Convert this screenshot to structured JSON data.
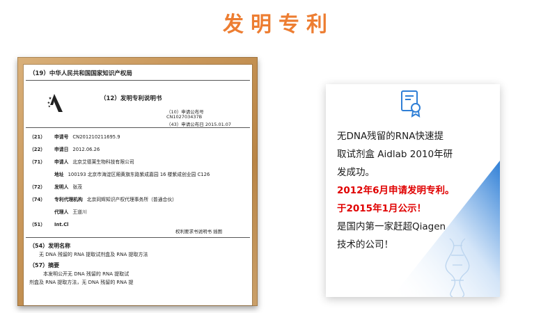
{
  "title": "发明专利",
  "patent": {
    "office": "（19）中华人民共和国国家知识产权局",
    "doc_type": "（12）发明专利说明书",
    "pub_no_label": "（10）申请公布号",
    "pub_no": "CN102703437B",
    "pub_date": "（43）申请公布日 2015.01.07",
    "fields": [
      {
        "num": "（21）",
        "label": "申请号",
        "value": "CN201210211695.9"
      },
      {
        "num": "（22）",
        "label": "申请日",
        "value": "2012.06.26"
      },
      {
        "num": "（71）",
        "label": "申请人",
        "value": "北京艾德莱生物科技有限公司"
      },
      {
        "num": "",
        "label": "地址",
        "value": "100193 北京市海淀区厢黄旗东路紫成嘉园 16 楼紫成创业园 C126"
      },
      {
        "num": "（72）",
        "label": "发明人",
        "value": "张茂"
      },
      {
        "num": "（74）",
        "label": "专利代理机构",
        "value": "北京同辉知识产权代理事务所（普通合伙）"
      },
      {
        "num": "",
        "label": "代理人",
        "value": "王道川"
      },
      {
        "num": "（51）",
        "label": "Int.Cl",
        "value": ""
      }
    ],
    "pages_note": "权利要求书说明书    插图",
    "name_heading": "（54）发明名称",
    "name_value": "无 DNA 残留的 RNA 提取试剂盒及 RNA 提取方法",
    "abstract_heading": "（57）摘要",
    "abstract_line1": "本发明公开无 DNA 残留的 RNA 提取试",
    "abstract_line2": "剂盒及 RNA 提取方法，无 DNA 残留的 RNA 提"
  },
  "card": {
    "icon": "certificate-icon",
    "line1": "无DNA残留的RNA快速提",
    "line2": "取试剂盒 Aidlab 2010年研",
    "line3": "发成功。",
    "line4": "2012年6月申请发明专利。",
    "line5": "于2015年1月公示！",
    "line6": "是国内第一家赶超Qiagen",
    "line7": "技术的公司！",
    "colors": {
      "highlight": "#e00000",
      "accent": "#2f7fd6",
      "title": "#ed7d31"
    }
  }
}
